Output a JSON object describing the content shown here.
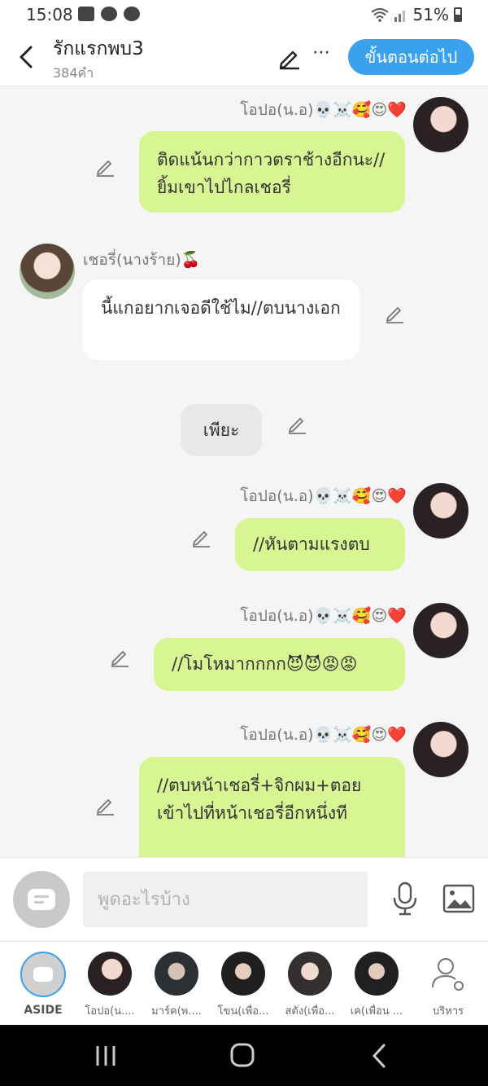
{
  "status_bar": {
    "time": "15:08",
    "battery": "51%",
    "icons": [
      "gallery-icon",
      "camera-icon",
      "line-icon",
      "wifi-icon",
      "signal-icon",
      "battery-icon"
    ]
  },
  "header": {
    "title": "รักแรกพบ3",
    "subtitle": "384คำ",
    "next_label": "ขั้นตอนต่อไป"
  },
  "messages": [
    {
      "sender": "โอปอ(น.อ)💀☠️🥰😍❤️",
      "text": "ติดแน้นกว่ากาวตราช้างอีกนะ//ยิ้มเขาไปไกลเชอรี่",
      "side": "right"
    },
    {
      "sender": "เชอรี่(นางร้าย)🍒",
      "text": "นี้แกอยากเจอดีใช้ไม//ตบนางเอก",
      "side": "left"
    },
    {
      "sender": "",
      "text": "เพียะ",
      "side": "center"
    },
    {
      "sender": "โอปอ(น.อ)💀☠️🥰😍❤️",
      "text": "//หันตามแรงตบ",
      "side": "right"
    },
    {
      "sender": "โอปอ(น.อ)💀☠️🥰😍❤️",
      "text": "//โมโหมากกกก😈😈😡😡",
      "side": "right"
    },
    {
      "sender": "โอปอ(น.อ)💀☠️🥰😍❤️",
      "text": "//ตบหน้าเชอรี่+จิกผม+ตอยเข้าไปที่หน้าเชอรี่อีกหนึ่งที",
      "side": "right"
    }
  ],
  "input": {
    "placeholder": "พูดอะไรบ้าง"
  },
  "tray": [
    {
      "label": "ASIDE"
    },
    {
      "label": "โอปอ(น...."
    },
    {
      "label": "มาร์ค(พ...."
    },
    {
      "label": "โขน(เพื่อ..."
    },
    {
      "label": "สตัง(เพื่อ..."
    },
    {
      "label": "เค(เพื่อน ..."
    },
    {
      "label": "บริหาร"
    }
  ]
}
